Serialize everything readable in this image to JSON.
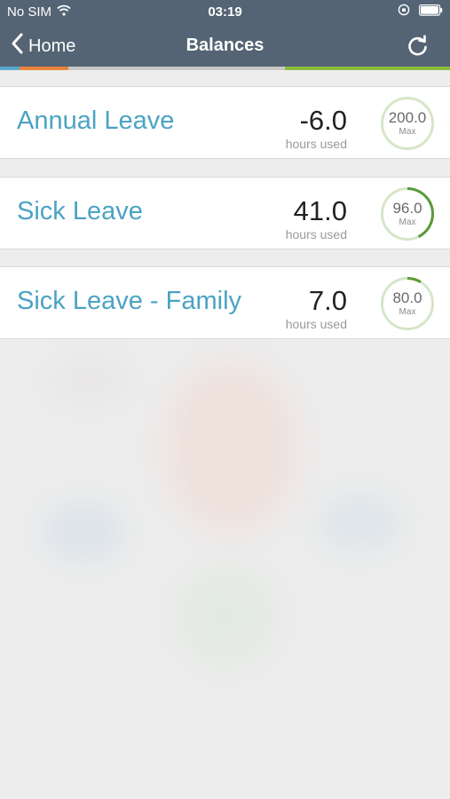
{
  "status_bar": {
    "carrier": "No SIM",
    "time": "03:19",
    "wifi_icon": "wifi-icon",
    "lock_icon": "orientation-lock-icon",
    "battery_icon": "battery-icon"
  },
  "nav": {
    "back_label": "Home",
    "title": "Balances",
    "refresh_icon": "refresh-icon"
  },
  "colors": {
    "nav_background": "#546474",
    "title_text": "#4ba3c3",
    "gauge_track": "#d6e6c8",
    "gauge_progress": "#5a9a3a",
    "stripe": [
      "#5aa8d0",
      "#e8843a",
      "#c8c8c8",
      "#8cbc3c"
    ]
  },
  "balances": [
    {
      "title": "Annual Leave",
      "value": "-6.0",
      "unit": "hours used",
      "max": "200.0",
      "max_label": "Max",
      "used_fraction": 0
    },
    {
      "title": "Sick Leave",
      "value": "41.0",
      "unit": "hours used",
      "max": "96.0",
      "max_label": "Max",
      "used_fraction": 0.427
    },
    {
      "title": "Sick Leave - Family",
      "value": "7.0",
      "unit": "hours used",
      "max": "80.0",
      "max_label": "Max",
      "used_fraction": 0.0875
    }
  ]
}
